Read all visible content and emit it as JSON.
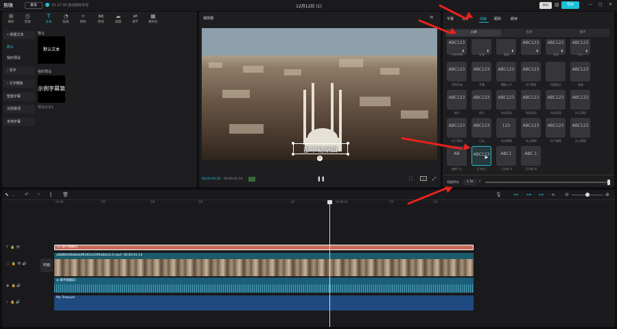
{
  "app": {
    "logo": "剪映",
    "menu_label": "菜单",
    "version_text": "15.27.39 自动保存本地",
    "title": "12月12日 (1)",
    "pro_label": "PRO",
    "export_label": "导出"
  },
  "toolbar": [
    "媒体",
    "音频",
    "文本",
    "贴纸",
    "特效",
    "转场",
    "滤镜",
    "调节",
    "素材包"
  ],
  "left_sidebar": [
    {
      "label": "• 新建文本",
      "active": true
    },
    {
      "label": "默认"
    },
    {
      "label": "我的预设"
    },
    {
      "label": "› 花字"
    },
    {
      "label": "› 文字模板"
    },
    {
      "label": "智能字幕"
    },
    {
      "label": "识别歌词"
    },
    {
      "label": "本地字幕"
    }
  ],
  "content": {
    "default_section": "默认",
    "default_card": "默认文本",
    "preset_section": "我的预设",
    "preset_card": "示例字幕第-",
    "preset_caption": "预设文本1"
  },
  "player": {
    "title": "播放器",
    "subtitle": "那不勒斯四",
    "time_current": "00:00:00:29",
    "time_total": "00:00:01:14"
  },
  "right_panel": {
    "tabs": [
      "字幕",
      "文本",
      "动画",
      "跟踪",
      "朗读"
    ],
    "active_tab": "动画",
    "segments": [
      "入场",
      "出场",
      "循环"
    ],
    "active_segment": "入场",
    "row0_labels": [
      "开始ADK",
      "生长",
      "波动",
      "",
      "羽化",
      "闪入"
    ],
    "rows": [
      {
        "tiles": [
          "ABC123",
          "ABC123",
          "ABC123",
          "ABC123",
          "",
          "ABC123"
        ],
        "labels": [
          "回到开始",
          "开幕",
          "螺旋上升",
          "向下撕开",
          "短暂放大",
          "收拢"
        ]
      },
      {
        "tiles": [
          "ABC123",
          "ABC123",
          "ABC123",
          "ABC123",
          "ABC123",
          "ABC123"
        ],
        "labels": [
          "缩小",
          "放大",
          "向左滑动",
          "向右滑动",
          "向右滑动",
          "向上滑动"
        ]
      },
      {
        "tiles": [
          "ABC123",
          "ABC123",
          "123",
          "ABC123",
          "ABC123",
          "ABC123"
        ],
        "labels": [
          "向下滑动",
          "日出",
          "向左擦除",
          "向上擦除",
          "向下擦除",
          "向上擦除"
        ]
      },
      {
        "tiles": [
          "AB",
          "ABC123",
          "ABC1",
          "ABC 1"
        ],
        "labels": [
          "旋转飞入",
          "打字机 I",
          "打字机 II",
          "打字机 III"
        ]
      }
    ],
    "duration_label": "动画时长",
    "duration_value": "1.5s"
  },
  "timeline": {
    "ruler": [
      "00:00",
      "15f",
      "10f",
      "12f",
      "12f",
      "00:00:01",
      "15f",
      "12f"
    ],
    "tracks": [
      {
        "type": "text",
        "label": "A1 那不勒斯四"
      },
      {
        "type": "video",
        "label": "afb880ef8a8dddf6162e2390a84c2c3.mp4",
        "duration": "00:00:01:14",
        "cover": "封面"
      },
      {
        "type": "audio",
        "label": "⊕ 那不勒斯四"
      },
      {
        "type": "music",
        "label": "My Treasure"
      }
    ]
  },
  "colors": {
    "accent": "#1ec0d4",
    "text_clip": "#c86a5a",
    "video_clip": "#1a5a6a",
    "audio_clip": "#1b5e7a",
    "music_clip": "#1e4a80",
    "annotation": "#e8231d"
  }
}
